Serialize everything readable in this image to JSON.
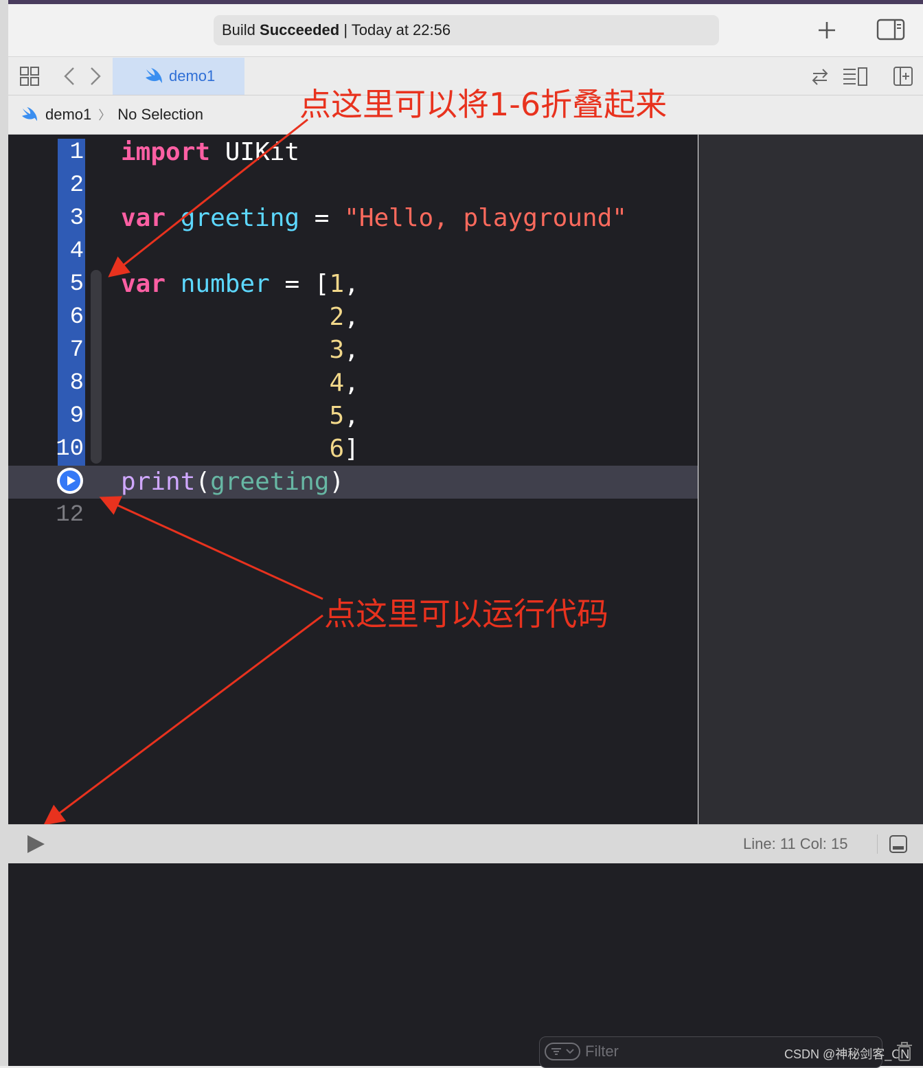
{
  "titlebar": {
    "status_prefix": "Build ",
    "status_bold": "Succeeded",
    "status_suffix": " | Today at 22:56"
  },
  "tabbar": {
    "active_tab": "demo1"
  },
  "jumpbar": {
    "project": "demo1",
    "separator": "〉",
    "selection": "No Selection"
  },
  "editor": {
    "lines": [
      {
        "n": "1",
        "tokens": [
          {
            "t": "import",
            "c": "kw"
          },
          {
            "t": " UIKit",
            "c": "plain"
          }
        ]
      },
      {
        "n": "2",
        "tokens": []
      },
      {
        "n": "3",
        "tokens": [
          {
            "t": "var",
            "c": "kw"
          },
          {
            "t": " ",
            "c": "plain"
          },
          {
            "t": "greeting",
            "c": "id"
          },
          {
            "t": " = ",
            "c": "plain"
          },
          {
            "t": "\"Hello, playground\"",
            "c": "str"
          }
        ]
      },
      {
        "n": "4",
        "tokens": []
      },
      {
        "n": "5",
        "tokens": [
          {
            "t": "var",
            "c": "kw"
          },
          {
            "t": " ",
            "c": "plain"
          },
          {
            "t": "number",
            "c": "id"
          },
          {
            "t": " = [",
            "c": "plain"
          },
          {
            "t": "1",
            "c": "num"
          },
          {
            "t": ",",
            "c": "plain"
          }
        ]
      },
      {
        "n": "6",
        "tokens": [
          {
            "t": "              ",
            "c": "plain"
          },
          {
            "t": "2",
            "c": "num"
          },
          {
            "t": ",",
            "c": "plain"
          }
        ]
      },
      {
        "n": "7",
        "tokens": [
          {
            "t": "              ",
            "c": "plain"
          },
          {
            "t": "3",
            "c": "num"
          },
          {
            "t": ",",
            "c": "plain"
          }
        ]
      },
      {
        "n": "8",
        "tokens": [
          {
            "t": "              ",
            "c": "plain"
          },
          {
            "t": "4",
            "c": "num"
          },
          {
            "t": ",",
            "c": "plain"
          }
        ]
      },
      {
        "n": "9",
        "tokens": [
          {
            "t": "              ",
            "c": "plain"
          },
          {
            "t": "5",
            "c": "num"
          },
          {
            "t": ",",
            "c": "plain"
          }
        ]
      },
      {
        "n": "10",
        "tokens": [
          {
            "t": "              ",
            "c": "plain"
          },
          {
            "t": "6",
            "c": "num"
          },
          {
            "t": "]",
            "c": "plain"
          }
        ]
      },
      {
        "n": "",
        "tokens": [
          {
            "t": "print",
            "c": "fn"
          },
          {
            "t": "(",
            "c": "plain"
          },
          {
            "t": "greeting",
            "c": "var"
          },
          {
            "t": ")",
            "c": "plain"
          }
        ]
      },
      {
        "n": "12",
        "tokens": []
      }
    ]
  },
  "debugbar": {
    "position": "Line: 11  Col: 15"
  },
  "console": {
    "filter_placeholder": "Filter",
    "watermark": "CSDN @神秘剑客_CN"
  },
  "annotations": {
    "fold_hint": "点这里可以将1-6折叠起来",
    "run_hint": "点这里可以运行代码"
  },
  "colors": {
    "accent": "#3478f6",
    "keyword": "#fc5fa3",
    "identifier": "#5dd8ff",
    "string": "#fc6a5d",
    "number": "#f2d88a",
    "annotation": "#e8321e"
  }
}
